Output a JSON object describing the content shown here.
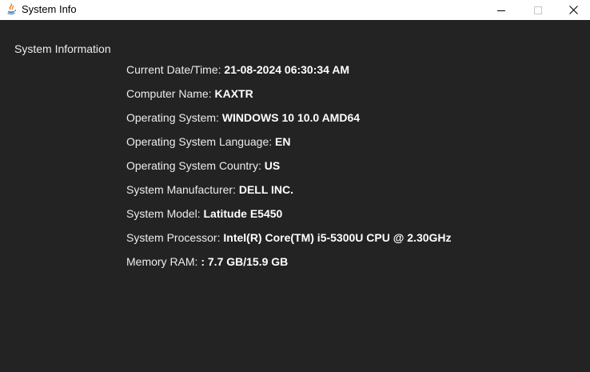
{
  "window": {
    "title": "System Info",
    "icon": "java-icon"
  },
  "colors": {
    "background": "#232323",
    "titlebar": "#ffffff",
    "text": "#ececec"
  },
  "section": {
    "title": "System Information"
  },
  "info": {
    "rows": [
      {
        "label": "Current Date/Time:",
        "value": "21-08-2024 06:30:34 AM"
      },
      {
        "label": "Computer Name:",
        "value": "KAXTR"
      },
      {
        "label": "Operating System:",
        "value": "WINDOWS 10 10.0 AMD64"
      },
      {
        "label": "Operating System Language:",
        "value": "EN"
      },
      {
        "label": "Operating System Country:",
        "value": "US"
      },
      {
        "label": "System Manufacturer:",
        "value": "DELL INC."
      },
      {
        "label": "System Model:",
        "value": "Latitude E5450"
      },
      {
        "label": "System Processor:",
        "value": "Intel(R) Core(TM) i5-5300U CPU @ 2.30GHz"
      },
      {
        "label": "Memory RAM:",
        "value": ": 7.7 GB/15.9 GB"
      }
    ]
  }
}
